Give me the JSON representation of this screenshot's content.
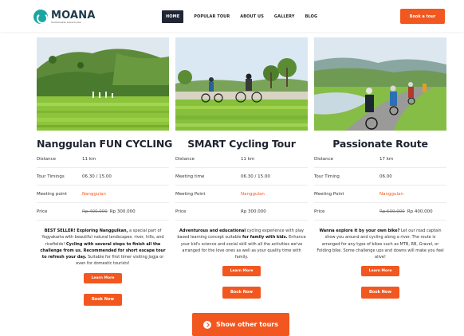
{
  "brand": {
    "name": "MOANA",
    "tagline": "Sustainable adventures"
  },
  "nav": [
    {
      "label": "HOME",
      "active": true
    },
    {
      "label": "POPULAR TOUR",
      "active": false
    },
    {
      "label": "ABOUT US",
      "active": false
    },
    {
      "label": "GALLERY",
      "active": false
    },
    {
      "label": "BLOG",
      "active": false
    }
  ],
  "header_cta": "Book a tour",
  "colors": {
    "accent": "#f2571f",
    "nav_active": "#202634",
    "brand": "#1aa6a0"
  },
  "tours": [
    {
      "title": "Nanggulan FUN CYCLING",
      "specs": [
        {
          "key": "Distance",
          "value": "11 km"
        },
        {
          "key": "Tour Timings",
          "value": "06.30 / 15.00"
        },
        {
          "key": "Meeting point",
          "value": "Nanggulan"
        },
        {
          "key": "Price",
          "old_price": "Rp 400.000",
          "value": "Rp 300.000"
        }
      ],
      "desc": {
        "p1": "BEST SELLER! Exploring Nanggulkan,",
        "p2": " a special part of Yogyakarta with beautiful natural landscapes: river, hills, and ricefields! ",
        "p3": "Cycling with several stops to finish all the challenge from us. Recommended for short escape tour to refresh your day.",
        "p4": " Suitable for first timer visiting Jogja or even for domestic tourists!"
      },
      "learn_more": "Learn More",
      "book_now": "Book Now"
    },
    {
      "title": "SMART Cycling Tour",
      "specs": [
        {
          "key": "Distance",
          "value": "11 km"
        },
        {
          "key": "Meeting time",
          "value": "06.30 / 15.00"
        },
        {
          "key": "Meeting Point",
          "value": "Nanggulan"
        },
        {
          "key": "Price",
          "value": "Rp 300.000"
        }
      ],
      "desc": {
        "p1": "Adventurous and educational",
        "p2": " cycling experience with play based learning concept suitable ",
        "p3": "for family with kids.",
        "p4": " Enhance your kid's science and social skill with all the activities we've arranged for the love ones as well as your quality time with family."
      },
      "learn_more": "Learn More",
      "book_now": "Book Now"
    },
    {
      "title": "Passionate Route",
      "specs": [
        {
          "key": "Distance",
          "value": "17 km"
        },
        {
          "key": "Tour Timing",
          "value": "06.00"
        },
        {
          "key": "Meeting Point",
          "value": "Nanggulan"
        },
        {
          "key": "Price",
          "old_price": "Rp 500.000",
          "value": "Rp 400.000"
        }
      ],
      "desc": {
        "p1": "Wanna explore it by your own bike?",
        "p2": " Let our road captain show you around and cycling along a river. The route is arranged for any type of bikes such as MTB, RB, Gravel, or Folding bike. Some challenge ups and downs will make you feel alive!",
        "p3": "",
        "p4": ""
      },
      "learn_more": "Learn More",
      "book_now": "Book Now"
    }
  ],
  "show_other": "Show other tours"
}
